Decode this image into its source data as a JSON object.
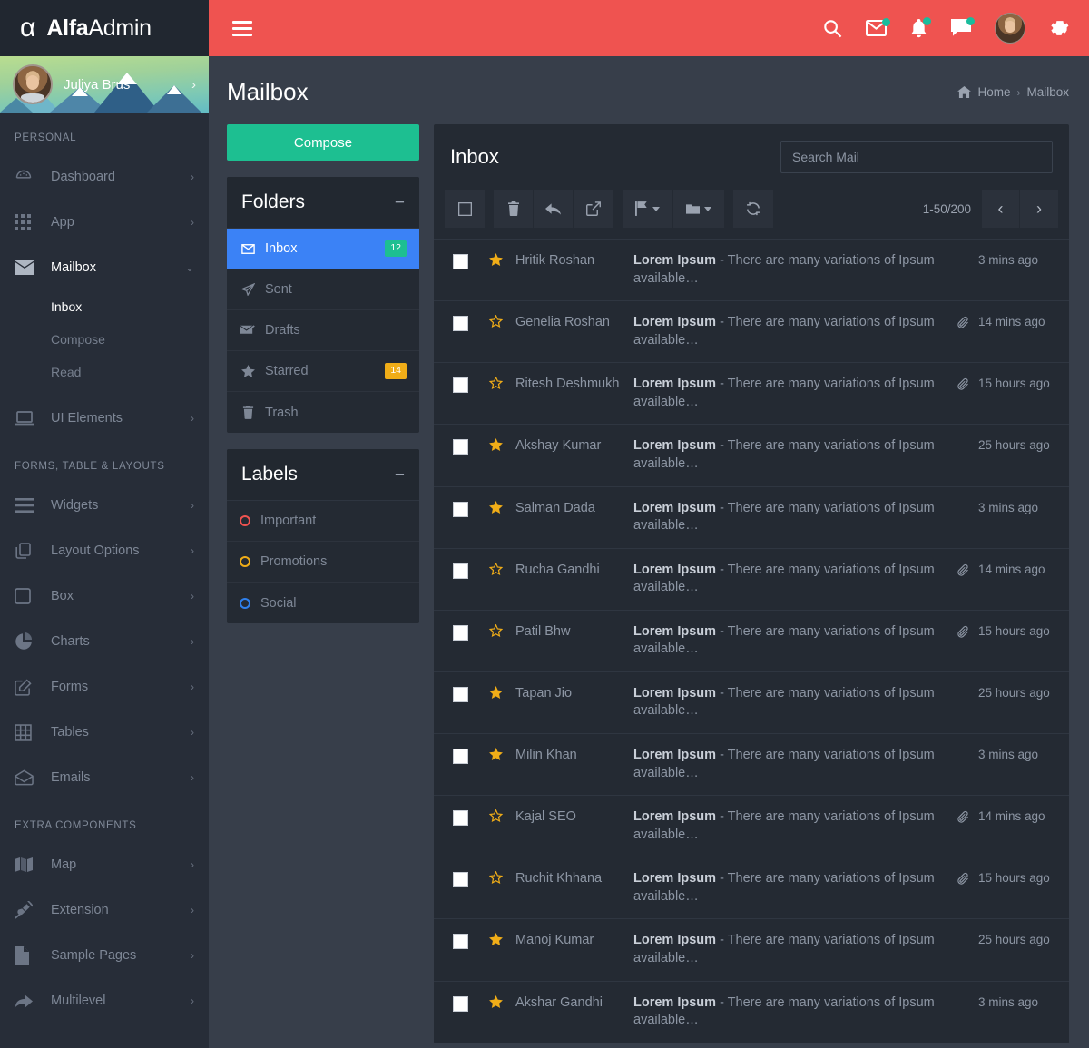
{
  "brand": {
    "mark": "α",
    "bold": "Alfa",
    "light": "Admin"
  },
  "profile": {
    "name": "Juliya Brus",
    "caret": "›"
  },
  "sidebar": {
    "sections": [
      {
        "heading": "PERSONAL",
        "items": [
          {
            "label": "Dashboard",
            "icon": "dashboard-icon",
            "arrow": "›",
            "active": false
          },
          {
            "label": "App",
            "icon": "grid-icon",
            "arrow": "›",
            "active": false
          },
          {
            "label": "Mailbox",
            "icon": "envelope-icon",
            "arrow": "⌄",
            "active": true,
            "children": [
              {
                "label": "Inbox",
                "active": true
              },
              {
                "label": "Compose",
                "active": false
              },
              {
                "label": "Read",
                "active": false
              }
            ]
          },
          {
            "label": "UI Elements",
            "icon": "laptop-icon",
            "arrow": "›",
            "active": false
          }
        ]
      },
      {
        "heading": "FORMS, TABLE & LAYOUTS",
        "items": [
          {
            "label": "Widgets",
            "icon": "lines-icon",
            "arrow": "›",
            "active": false
          },
          {
            "label": "Layout Options",
            "icon": "copy-icon",
            "arrow": "›",
            "active": false
          },
          {
            "label": "Box",
            "icon": "square-icon",
            "arrow": "›",
            "active": false
          },
          {
            "label": "Charts",
            "icon": "pie-chart-icon",
            "arrow": "›",
            "active": false
          },
          {
            "label": "Forms",
            "icon": "pencil-square-icon",
            "arrow": "›",
            "active": false
          },
          {
            "label": "Tables",
            "icon": "table-icon",
            "arrow": "›",
            "active": false
          },
          {
            "label": "Emails",
            "icon": "open-envelope-icon",
            "arrow": "›",
            "active": false
          }
        ]
      },
      {
        "heading": "EXTRA COMPONENTS",
        "items": [
          {
            "label": "Map",
            "icon": "map-icon",
            "arrow": "›",
            "active": false
          },
          {
            "label": "Extension",
            "icon": "plug-icon",
            "arrow": "›",
            "active": false
          },
          {
            "label": "Sample Pages",
            "icon": "file-icon",
            "arrow": "›",
            "active": false
          },
          {
            "label": "Multilevel",
            "icon": "arrow-curve-icon",
            "arrow": "›",
            "active": false
          }
        ]
      }
    ]
  },
  "navbar": {
    "icons": [
      "search-icon",
      "envelope-icon",
      "bell-icon",
      "chat-icon",
      "avatar",
      "gear-icon"
    ],
    "accent": "#ef5350",
    "dot_color": "#1abc9c"
  },
  "page": {
    "title": "Mailbox",
    "breadcrumb": {
      "home": "Home",
      "sep": "›",
      "current": "Mailbox"
    }
  },
  "mail_sidebar": {
    "compose_label": "Compose",
    "folders_panel": {
      "title": "Folders",
      "minimize": "−"
    },
    "folders": [
      {
        "label": "Inbox",
        "icon": "envelope-icon",
        "badge": "12",
        "badge_color": "green",
        "active": true
      },
      {
        "label": "Sent",
        "icon": "paper-plane-icon",
        "badge": "",
        "badge_color": "",
        "active": false
      },
      {
        "label": "Drafts",
        "icon": "draft-icon",
        "badge": "",
        "badge_color": "",
        "active": false
      },
      {
        "label": "Starred",
        "icon": "star-icon",
        "badge": "14",
        "badge_color": "amber",
        "active": false
      },
      {
        "label": "Trash",
        "icon": "trash-icon",
        "badge": "",
        "badge_color": "",
        "active": false
      }
    ],
    "labels_panel": {
      "title": "Labels",
      "minimize": "−"
    },
    "labels": [
      {
        "label": "Important",
        "color": "#ef5350"
      },
      {
        "label": "Promotions",
        "color": "#f0ad18"
      },
      {
        "label": "Social",
        "color": "#2f80ed"
      }
    ]
  },
  "inbox": {
    "title": "Inbox",
    "search_placeholder": "Search Mail",
    "search_value": "",
    "toolbar": [
      {
        "name": "select-all-checkbox",
        "icon": "square-icon"
      },
      {
        "name": "delete-button",
        "icon": "trash-icon"
      },
      {
        "name": "reply-button",
        "icon": "reply-arrow-icon"
      },
      {
        "name": "forward-button",
        "icon": "share-icon"
      },
      {
        "name": "flag-dropdown",
        "icon": "flag-icon"
      },
      {
        "name": "move-to-folder-dropdown",
        "icon": "folder-icon"
      },
      {
        "name": "refresh-button",
        "icon": "refresh-icon"
      }
    ],
    "pagination": {
      "count": "1-50/200",
      "prev": "‹",
      "next": "›"
    },
    "messages": [
      {
        "from": "Hritik Roshan",
        "subject_bold": "Lorem Ipsum",
        "subject_rest": "- There are many variations of Ipsum available…",
        "time": "3 mins ago",
        "starred": true,
        "attachment": false
      },
      {
        "from": "Genelia Roshan",
        "subject_bold": "Lorem Ipsum",
        "subject_rest": "- There are many variations of Ipsum available…",
        "time": "14 mins ago",
        "starred": false,
        "attachment": true
      },
      {
        "from": "Ritesh Deshmukh",
        "subject_bold": "Lorem Ipsum",
        "subject_rest": "- There are many variations of Ipsum available…",
        "time": "15 hours ago",
        "starred": false,
        "attachment": true
      },
      {
        "from": "Akshay Kumar",
        "subject_bold": "Lorem Ipsum",
        "subject_rest": "- There are many variations of Ipsum available…",
        "time": "25 hours ago",
        "starred": true,
        "attachment": false
      },
      {
        "from": "Salman Dada",
        "subject_bold": "Lorem Ipsum",
        "subject_rest": "- There are many variations of Ipsum available…",
        "time": "3 mins ago",
        "starred": true,
        "attachment": false
      },
      {
        "from": "Rucha Gandhi",
        "subject_bold": "Lorem Ipsum",
        "subject_rest": "- There are many variations of Ipsum available…",
        "time": "14 mins ago",
        "starred": false,
        "attachment": true
      },
      {
        "from": "Patil Bhw",
        "subject_bold": "Lorem Ipsum",
        "subject_rest": "- There are many variations of Ipsum available…",
        "time": "15 hours ago",
        "starred": false,
        "attachment": true
      },
      {
        "from": "Tapan Jio",
        "subject_bold": "Lorem Ipsum",
        "subject_rest": "- There are many variations of Ipsum available…",
        "time": "25 hours ago",
        "starred": true,
        "attachment": false
      },
      {
        "from": "Milin Khan",
        "subject_bold": "Lorem Ipsum",
        "subject_rest": "- There are many variations of Ipsum available…",
        "time": "3 mins ago",
        "starred": true,
        "attachment": false
      },
      {
        "from": "Kajal SEO",
        "subject_bold": "Lorem Ipsum",
        "subject_rest": "- There are many variations of Ipsum available…",
        "time": "14 mins ago",
        "starred": false,
        "attachment": true
      },
      {
        "from": "Ruchit Khhana",
        "subject_bold": "Lorem Ipsum",
        "subject_rest": "- There are many variations of Ipsum available…",
        "time": "15 hours ago",
        "starred": false,
        "attachment": true
      },
      {
        "from": "Manoj Kumar",
        "subject_bold": "Lorem Ipsum",
        "subject_rest": "- There are many variations of Ipsum available…",
        "time": "25 hours ago",
        "starred": true,
        "attachment": false
      },
      {
        "from": "Akshar Gandhi",
        "subject_bold": "Lorem Ipsum",
        "subject_rest": "- There are many variations of Ipsum available…",
        "time": "3 mins ago",
        "starred": true,
        "attachment": false
      }
    ]
  }
}
